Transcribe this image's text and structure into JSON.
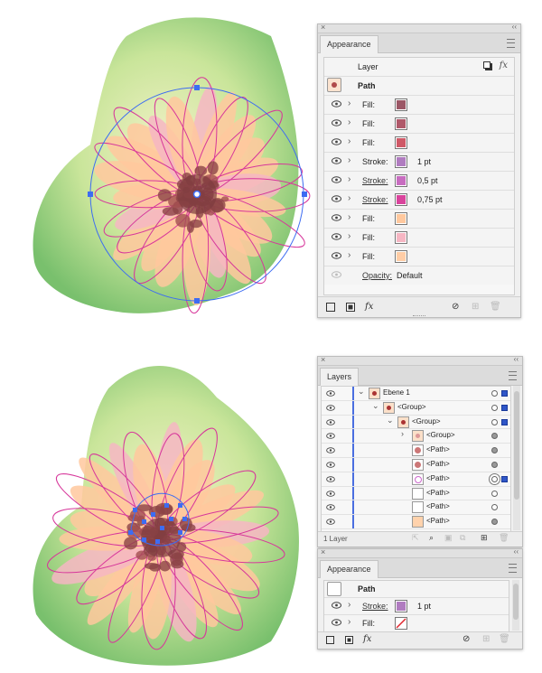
{
  "appearance_top": {
    "tab": "Appearance",
    "layer_label": "Layer",
    "object_label": "Path",
    "fx_label": "fx",
    "rows": [
      {
        "label": "Fill:",
        "value": "",
        "color": "#9c5766",
        "underline": false
      },
      {
        "label": "Fill:",
        "value": "",
        "color": "#b0596a",
        "underline": false
      },
      {
        "label": "Fill:",
        "value": "",
        "color": "#cf5967",
        "underline": false
      },
      {
        "label": "Stroke:",
        "value": "1 pt",
        "color": "#b07cc0",
        "underline": false
      },
      {
        "label": "Stroke:",
        "value": "0,5 pt",
        "color": "#c86dc0",
        "underline": true
      },
      {
        "label": "Stroke:",
        "value": "0,75 pt",
        "color": "#d9449c",
        "underline": true
      },
      {
        "label": "Fill:",
        "value": "",
        "color": "#ffc89e",
        "underline": false
      },
      {
        "label": "Fill:",
        "value": "",
        "color": "#f6b6c3",
        "underline": false
      },
      {
        "label": "Fill:",
        "value": "",
        "color": "#ffcda6",
        "underline": false
      }
    ],
    "opacity_label": "Opacity:",
    "opacity_value": "Default"
  },
  "layers": {
    "tab": "Layers",
    "footer": "1 Layer",
    "rows": [
      {
        "name": "Ebene 1",
        "indent": 0,
        "expanded": true,
        "thumb": "flower"
      },
      {
        "name": "<Group>",
        "indent": 1,
        "expanded": true,
        "thumb": "flower"
      },
      {
        "name": "<Group>",
        "indent": 2,
        "expanded": true,
        "thumb": "flower"
      },
      {
        "name": "<Group>",
        "indent": 3,
        "expanded": false,
        "thumb": "small"
      },
      {
        "name": "<Path>",
        "indent": 3,
        "expanded": false,
        "thumb": "center"
      },
      {
        "name": "<Path>",
        "indent": 3,
        "expanded": false,
        "thumb": "center"
      },
      {
        "name": "<Path>",
        "indent": 3,
        "expanded": false,
        "thumb": "outline"
      },
      {
        "name": "<Path>",
        "indent": 3,
        "expanded": false,
        "thumb": "blank"
      },
      {
        "name": "<Path>",
        "indent": 3,
        "expanded": false,
        "thumb": "blank"
      },
      {
        "name": "<Path>",
        "indent": 3,
        "expanded": false,
        "thumb": "petal"
      }
    ]
  },
  "appearance_bottom": {
    "tab": "Appearance",
    "object_label": "Path",
    "fx_label": "fx",
    "rows": [
      {
        "label": "Stroke:",
        "value": "1 pt",
        "color": "#b07cc0",
        "underline": true
      },
      {
        "label": "Fill:",
        "value": "",
        "color": "none",
        "underline": false
      }
    ]
  },
  "colors": {
    "leaf_light": "#dbe9a5",
    "leaf_dark": "#7fc36e",
    "petal": "#ffc89e",
    "petal_pink": "#f6b6c3",
    "center": "#8c4346",
    "stroke_magenta": "#d7379b",
    "selection_blue": "#3d6cf2"
  }
}
